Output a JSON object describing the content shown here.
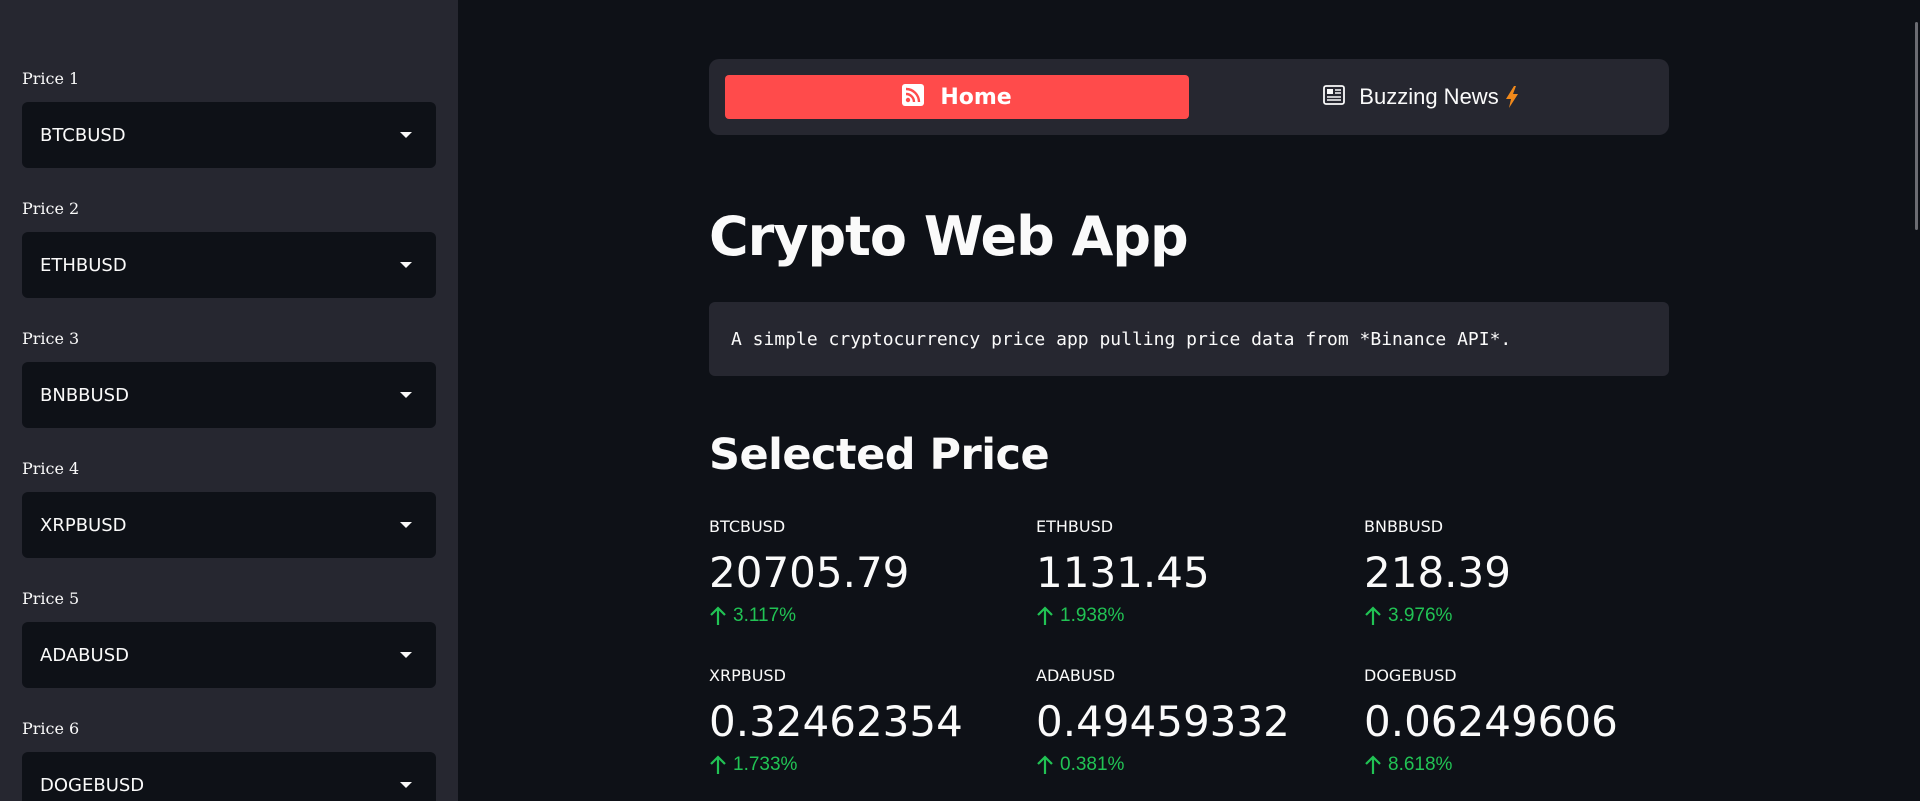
{
  "sidebar": {
    "selects": [
      {
        "label": "Price 1",
        "value": "BTCBUSD"
      },
      {
        "label": "Price 2",
        "value": "ETHBUSD"
      },
      {
        "label": "Price 3",
        "value": "BNBBUSD"
      },
      {
        "label": "Price 4",
        "value": "XRPBUSD"
      },
      {
        "label": "Price 5",
        "value": "ADABUSD"
      },
      {
        "label": "Price 6",
        "value": "DOGEBUSD"
      }
    ]
  },
  "nav": {
    "home_label": "Home",
    "home_icon": "rss-icon",
    "news_label": "Buzzing News",
    "news_icon": "newspaper-icon",
    "news_suffix_icon": "lightning-icon",
    "active_color": "#ff4b4b"
  },
  "main": {
    "title": "Crypto Web App",
    "description": "A simple cryptocurrency price app pulling price data from *Binance API*.",
    "section_title": "Selected Price"
  },
  "metrics": [
    {
      "label": "BTCBUSD",
      "value": "20705.79",
      "delta": "3.117%"
    },
    {
      "label": "ETHBUSD",
      "value": "1131.45",
      "delta": "1.938%"
    },
    {
      "label": "BNBBUSD",
      "value": "218.39",
      "delta": "3.976%"
    },
    {
      "label": "XRPBUSD",
      "value": "0.32462354",
      "delta": "1.733%"
    },
    {
      "label": "ADABUSD",
      "value": "0.49459332",
      "delta": "0.381%"
    },
    {
      "label": "DOGEBUSD",
      "value": "0.06249606",
      "delta": "8.618%"
    }
  ],
  "colors": {
    "background": "#0e1117",
    "sidebar": "#262730",
    "accent": "#ff4b4b",
    "positive": "#21c354"
  }
}
